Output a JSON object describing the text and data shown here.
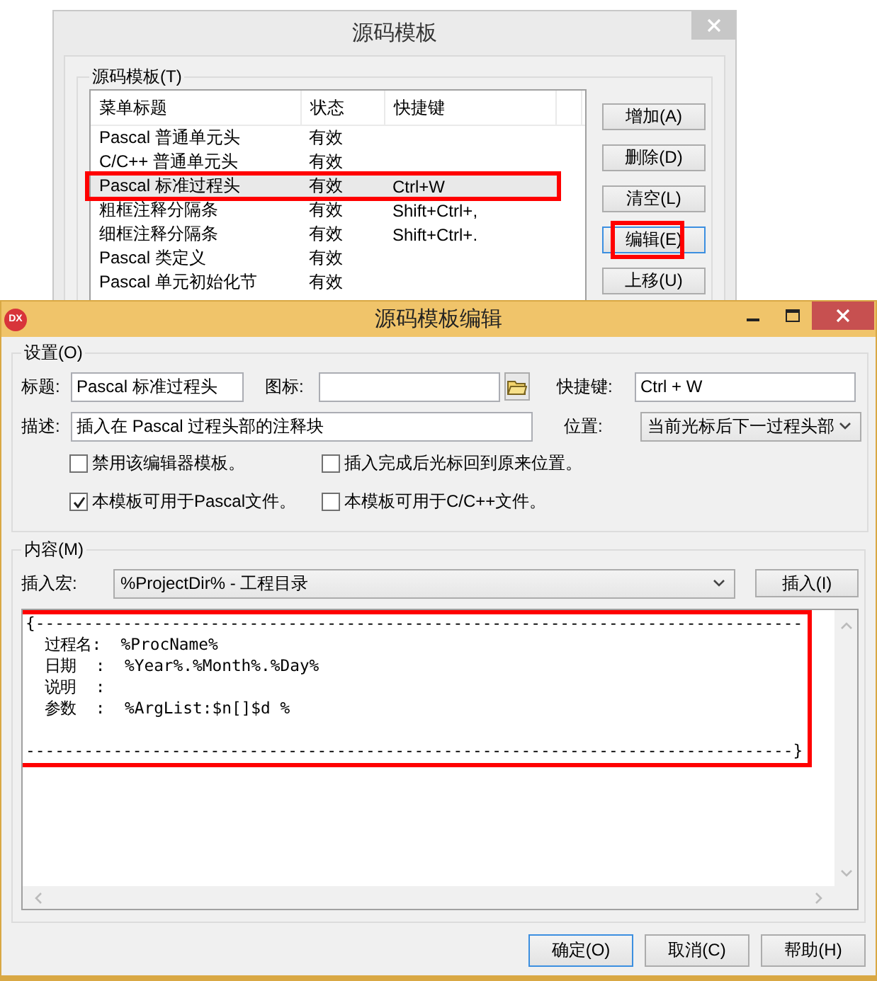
{
  "background_window": {
    "title": "源码模板",
    "group_label": "源码模板(T)",
    "list": {
      "columns": [
        "菜单标题",
        "状态",
        "快捷键"
      ],
      "rows": [
        {
          "title": "Pascal 普通单元头",
          "status": "有效",
          "selected": false,
          "highlighted": false
        },
        {
          "title": "C/C++ 普通单元头",
          "status": "有效",
          "selected": false,
          "highlighted": false
        },
        {
          "title": "Pascal 标准过程头",
          "status": "有效",
          "shortcut": "Ctrl+W",
          "selected": true,
          "highlighted": true
        },
        {
          "title": "粗框注释分隔条",
          "status": "有效",
          "shortcut": "Shift+Ctrl+,",
          "selected": false,
          "highlighted": false
        },
        {
          "title": "细框注释分隔条",
          "status": "有效",
          "shortcut": "Shift+Ctrl+.",
          "selected": false,
          "highlighted": false
        },
        {
          "title": "Pascal 类定义",
          "status": "有效",
          "selected": false,
          "highlighted": false
        },
        {
          "title": "Pascal 单元初始化节",
          "status": "有效",
          "selected": false,
          "highlighted": false
        }
      ]
    },
    "buttons": [
      {
        "label": "增加(A)",
        "focused": false,
        "highlighted": false
      },
      {
        "label": "删除(D)",
        "focused": false,
        "highlighted": false
      },
      {
        "label": "清空(L)",
        "focused": false,
        "highlighted": false
      },
      {
        "label": "编辑(E)",
        "focused": true,
        "highlighted": true
      },
      {
        "label": "上移(U)",
        "focused": false,
        "highlighted": false
      }
    ]
  },
  "window": {
    "title": "源码模板编辑",
    "app_icon": "DX"
  },
  "settings": {
    "group_label": "设置(O)",
    "title_label": "标题:",
    "title_value": "Pascal 标准过程头",
    "icon_label": "图标:",
    "shortcut_label": "快捷键:",
    "shortcut_value": "Ctrl + W",
    "description_label": "描述:",
    "description_value": "插入在 Pascal 过程头部的注释块",
    "position_label": "位置:",
    "position_value": "当前光标后下一过程头部",
    "checkboxes": [
      {
        "label": "禁用该编辑器模板。",
        "checked": false
      },
      {
        "label": "插入完成后光标回到原来位置。",
        "checked": false
      },
      {
        "label": "本模板可用于Pascal文件。",
        "checked": true
      },
      {
        "label": "本模板可用于C/C++文件。",
        "checked": false
      }
    ]
  },
  "content": {
    "group_label": "内容(M)",
    "macro_label": "插入宏:",
    "macro_value": "%ProjectDir% - 工程目录",
    "insert_button": "插入(I)",
    "editor": {
      "highlighted": true,
      "text": "{-------------------------------------------------------------------------------\n  过程名:  %ProcName%\n  日期  :  %Year%.%Month%.%Day%\n  说明  :\n  参数  :  %ArgList:$n[]$d %\n\n-------------------------------------------------------------------------------}"
    }
  },
  "footer_buttons": [
    {
      "label": "确定(O)",
      "focused": true
    },
    {
      "label": "取消(C)",
      "focused": false
    },
    {
      "label": "帮助(H)",
      "focused": false
    }
  ]
}
